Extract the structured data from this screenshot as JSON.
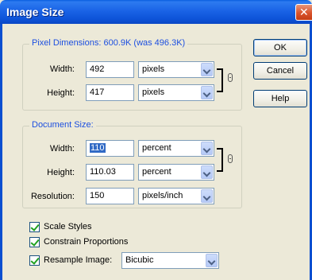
{
  "window": {
    "title": "Image Size"
  },
  "pixel_dimensions": {
    "label": "Pixel Dimensions:",
    "summary": "600.9K (was 496.3K)",
    "width": {
      "label": "Width:",
      "value": "492",
      "unit": "pixels"
    },
    "height": {
      "label": "Height:",
      "value": "417",
      "unit": "pixels"
    }
  },
  "document_size": {
    "label": "Document Size:",
    "width": {
      "label": "Width:",
      "value": "110",
      "unit": "percent"
    },
    "height": {
      "label": "Height:",
      "value": "110.03",
      "unit": "percent"
    },
    "resolution": {
      "label": "Resolution:",
      "value": "150",
      "unit": "pixels/inch"
    }
  },
  "buttons": {
    "ok": "OK",
    "cancel": "Cancel",
    "help": "Help"
  },
  "options": {
    "scale_styles": {
      "label": "Scale Styles",
      "checked": true
    },
    "constrain_proportions": {
      "label": "Constrain Proportions",
      "checked": true
    },
    "resample_image": {
      "label": "Resample Image:",
      "checked": true,
      "method": "Bicubic"
    }
  },
  "colors": {
    "title_bar": "#0a5ee0",
    "legend_text": "#1c4fe0",
    "dialog_bg": "#ece9d8",
    "selection": "#316ac5"
  }
}
